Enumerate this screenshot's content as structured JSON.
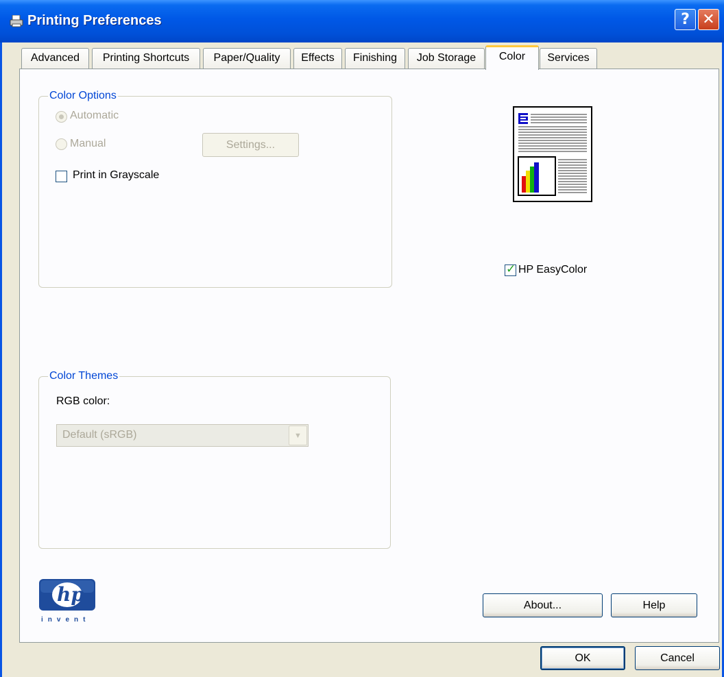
{
  "window": {
    "title": "Printing Preferences",
    "help_button": "?",
    "close_button": "✕"
  },
  "tabs": [
    {
      "label": "Advanced",
      "active": false
    },
    {
      "label": "Printing Shortcuts",
      "active": false
    },
    {
      "label": "Paper/Quality",
      "active": false
    },
    {
      "label": "Effects",
      "active": false
    },
    {
      "label": "Finishing",
      "active": false
    },
    {
      "label": "Job Storage",
      "active": false
    },
    {
      "label": "Color",
      "active": true
    },
    {
      "label": "Services",
      "active": false
    }
  ],
  "color_options": {
    "title": "Color Options",
    "automatic_label": "Automatic",
    "automatic_selected": true,
    "manual_label": "Manual",
    "settings_button": "Settings...",
    "grayscale_label": "Print in Grayscale",
    "grayscale_checked": false
  },
  "easycolor": {
    "label": "HP EasyColor",
    "checked": true
  },
  "color_themes": {
    "title": "Color Themes",
    "rgb_label": "RGB color:",
    "rgb_value": "Default (sRGB)"
  },
  "logo": {
    "text": "hp",
    "tagline": "invent"
  },
  "buttons": {
    "about": "About...",
    "help": "Help",
    "ok": "OK",
    "cancel": "Cancel"
  },
  "colors": {
    "accent": "#0046D5",
    "titlebar": "#0058E6",
    "check": "#21A121"
  }
}
